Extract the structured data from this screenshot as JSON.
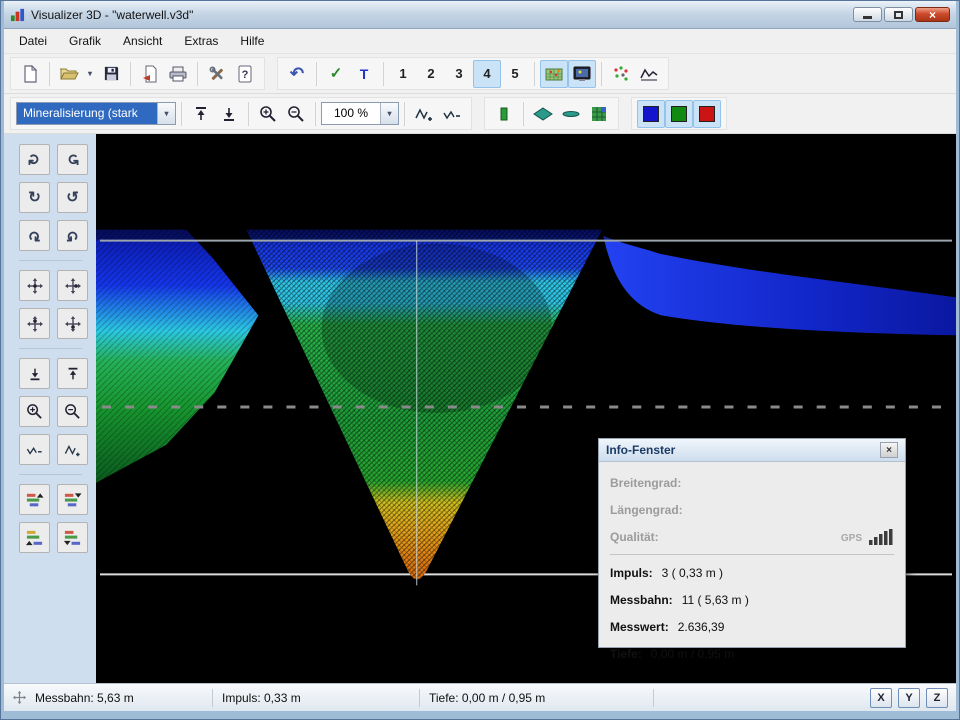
{
  "window": {
    "title": "Visualizer 3D - \"waterwell.v3d\""
  },
  "menu": {
    "items": [
      "Datei",
      "Grafik",
      "Ansicht",
      "Extras",
      "Hilfe"
    ]
  },
  "toolbar": {
    "views": [
      "1",
      "2",
      "3",
      "4",
      "5"
    ],
    "active_view": "4"
  },
  "options": {
    "layer_value": "Mineralisierung (stark",
    "zoom_value": "100 %"
  },
  "icons": {
    "close": "×",
    "dropdown": "▾",
    "undo": "↶",
    "check_curve": "✓",
    "t_tool": "T",
    "rotate_cw": "↻",
    "rotate_ccw": "↺"
  },
  "palette": {
    "selection_blue": "#2f6ac0",
    "square_blue": "#1414cc",
    "square_green": "#128a12",
    "square_red": "#cc1414"
  },
  "scene": {
    "colors": {
      "deep_blue": "#0a18b0",
      "blue": "#1838e8",
      "cyan": "#2fc6e6",
      "green": "#1e9c38",
      "yellow": "#cfc01f",
      "orange": "#e08414"
    }
  },
  "info_panel": {
    "title": "Info-Fenster",
    "gps_rows": [
      {
        "label": "Breitengrad:"
      },
      {
        "label": "Längengrad:"
      },
      {
        "label": "Qualität:"
      }
    ],
    "gps_tag": "GPS",
    "rows": [
      {
        "label": "Impuls:",
        "value": "3 ( 0,33 m )"
      },
      {
        "label": "Messbahn:",
        "value": "11 ( 5,63 m )"
      },
      {
        "label": "Messwert:",
        "value": "2.636,39"
      },
      {
        "label": "Tiefe:",
        "value": "0,00 m / 0,95 m"
      }
    ]
  },
  "status": {
    "messbahn": "Messbahn: 5,63 m",
    "impuls": "Impuls: 0,33 m",
    "tiefe": "Tiefe: 0,00 m / 0,95 m",
    "axes": [
      "X",
      "Y",
      "Z"
    ]
  }
}
